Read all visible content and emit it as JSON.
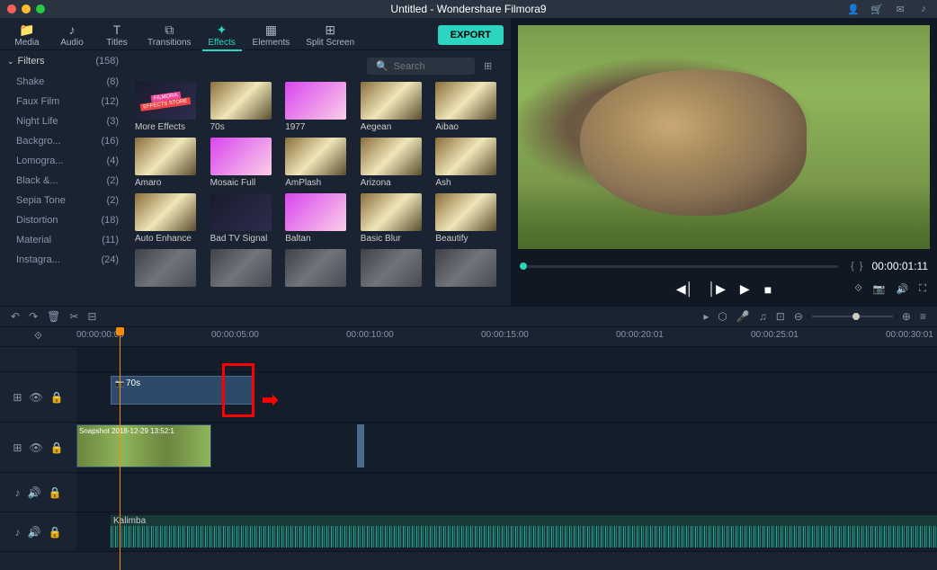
{
  "window": {
    "title": "Untitled - Wondershare Filmora9"
  },
  "tabs": [
    {
      "label": "Media"
    },
    {
      "label": "Audio"
    },
    {
      "label": "Titles"
    },
    {
      "label": "Transitions"
    },
    {
      "label": "Effects"
    },
    {
      "label": "Elements"
    },
    {
      "label": "Split Screen"
    }
  ],
  "export_label": "EXPORT",
  "sidebar": {
    "header": {
      "label": "Filters",
      "count": "(158)"
    },
    "items": [
      {
        "label": "Shake",
        "count": "(8)"
      },
      {
        "label": "Faux Film",
        "count": "(12)"
      },
      {
        "label": "Night Life",
        "count": "(3)"
      },
      {
        "label": "Backgro...",
        "count": "(16)"
      },
      {
        "label": "Lomogra...",
        "count": "(4)"
      },
      {
        "label": "Black &...",
        "count": "(2)"
      },
      {
        "label": "Sepia Tone",
        "count": "(2)"
      },
      {
        "label": "Distortion",
        "count": "(18)"
      },
      {
        "label": "Material",
        "count": "(11)"
      },
      {
        "label": "Instagra...",
        "count": "(24)"
      }
    ]
  },
  "search": {
    "placeholder": "Search"
  },
  "thumbs": [
    {
      "label": "More Effects",
      "cls": "effects-store"
    },
    {
      "label": "70s",
      "cls": ""
    },
    {
      "label": "1977",
      "cls": "pink"
    },
    {
      "label": "Aegean",
      "cls": ""
    },
    {
      "label": "Aibao",
      "cls": ""
    },
    {
      "label": "Amaro",
      "cls": ""
    },
    {
      "label": "Mosaic Full",
      "cls": "pink"
    },
    {
      "label": "AmPlash",
      "cls": ""
    },
    {
      "label": "Arizona",
      "cls": ""
    },
    {
      "label": "Ash",
      "cls": ""
    },
    {
      "label": "Auto Enhance",
      "cls": ""
    },
    {
      "label": "Bad TV Signal",
      "cls": "dark"
    },
    {
      "label": "Baltan",
      "cls": "pink"
    },
    {
      "label": "Basic Blur",
      "cls": ""
    },
    {
      "label": "Beautify",
      "cls": ""
    },
    {
      "label": "",
      "cls": "gray"
    },
    {
      "label": "",
      "cls": "gray"
    },
    {
      "label": "",
      "cls": "gray"
    },
    {
      "label": "",
      "cls": "gray"
    },
    {
      "label": "",
      "cls": "gray"
    }
  ],
  "preview": {
    "timecode": "00:00:01:11"
  },
  "ruler": [
    "00:00:00:00",
    "00:00:05:00",
    "00:00:10:00",
    "00:00:15:00",
    "00:00:20:01",
    "00:00:25:01",
    "00:00:30:01"
  ],
  "timeline": {
    "effect_clip": "70s",
    "video_clip": "Snapshot 2018-12-29 13:52:1",
    "audio_clip": "Kalimba"
  }
}
